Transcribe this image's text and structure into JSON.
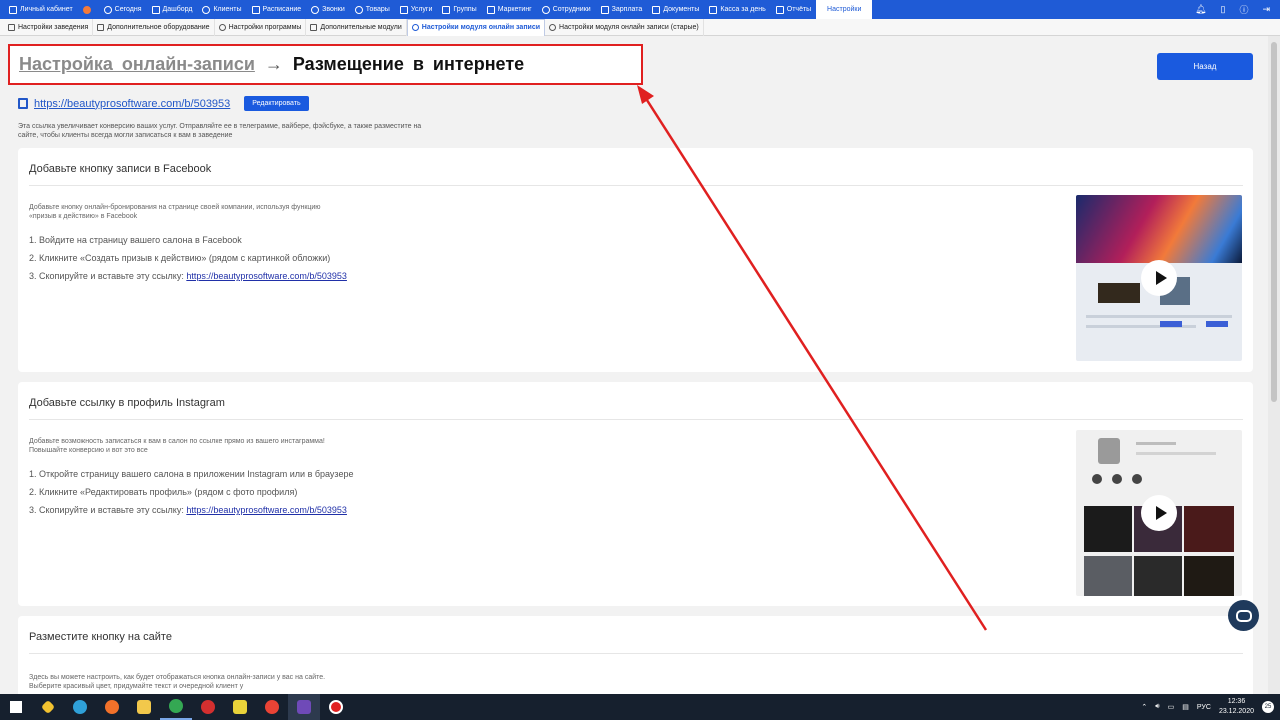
{
  "topnav": {
    "items": [
      {
        "label": "Личный кабинет",
        "icon": "user-card-icon"
      },
      {
        "label": "",
        "icon": "round-badge-icon"
      },
      {
        "label": "Сегодня",
        "icon": "calendar-today-icon"
      },
      {
        "label": "Дашборд",
        "icon": "chart-icon"
      },
      {
        "label": "Клиенты",
        "icon": "client-icon"
      },
      {
        "label": "Расписание",
        "icon": "schedule-icon"
      },
      {
        "label": "Звонки",
        "icon": "phone-icon"
      },
      {
        "label": "Товары",
        "icon": "goods-icon"
      },
      {
        "label": "Услуги",
        "icon": "lightning-icon"
      },
      {
        "label": "Группы",
        "icon": "group-icon"
      },
      {
        "label": "Маркетинг",
        "icon": "megaphone-icon"
      },
      {
        "label": "Сотрудники",
        "icon": "staff-icon"
      },
      {
        "label": "Зарплата",
        "icon": "salary-icon"
      },
      {
        "label": "Документы",
        "icon": "document-icon"
      },
      {
        "label": "Касса за день",
        "icon": "cash-register-icon"
      },
      {
        "label": "Отчёты",
        "icon": "reports-icon"
      }
    ],
    "active_label": "Настройки"
  },
  "subtabs": [
    {
      "label": "Настройки заведения"
    },
    {
      "label": "Дополнительное оборудование"
    },
    {
      "label": "Настройки программы"
    },
    {
      "label": "Дополнительные модули"
    },
    {
      "label": "Настройки модуля онлайн записи",
      "active": true
    },
    {
      "label": "Настройки модуля онлайн записи (старые)"
    }
  ],
  "page": {
    "breadcrumb_parent": "Настройка онлайн-записи",
    "breadcrumb_arrow": "→",
    "breadcrumb_current": "Размещение в интернете",
    "back_label": "Назад",
    "link_url": "https://beautyprosoftware.com/b/503953",
    "edit_label": "Редактировать",
    "hint": "Эта ссылка увеличивает конверсию ваших услуг. Отправляйте ее в телеграмме, вайбере, фэйсбуке, а также разместите на сайте, чтобы клиенты всегда могли записаться к вам в заведение"
  },
  "facebook": {
    "title": "Добавьте кнопку записи в Facebook",
    "desc": "Добавьте кнопку онлайн-бронирования на странице своей компании, используя функцию «призыв к действию» в Facebook",
    "step1": "1. Войдите на страницу вашего салона в Facebook",
    "step2": "2. Кликните «Создать призыв к действию» (рядом с картинкой обложки)",
    "step3_text": "3. Скопируйте и вставьте эту ссылку: ",
    "step3_link": "https://beautyprosoftware.com/b/503953"
  },
  "instagram": {
    "title": "Добавьте ссылку в профиль Instagram",
    "desc": "Добавьте возможность записаться к вам в салон по ссылке прямо из вашего инстаграмма! Повышайте конверсию и вот это все",
    "step1": "1. Откройте страницу вашего салона в приложении Instagram или в браузере",
    "step2": "2. Кликните «Редактировать профиль» (рядом с фото профиля)",
    "step3_text": "3. Скопируйте и вставьте эту ссылку: ",
    "step3_link": "https://beautyprosoftware.com/b/503953"
  },
  "site": {
    "title": "Разместите кнопку на сайте",
    "desc": "Здесь вы можете настроить, как будет отображаться кнопка онлайн-записи у вас на сайте. Выберите красивый цвет, придумайте текст и очередной клиент у"
  },
  "taskbar": {
    "lang": "РУС",
    "time": "12:36",
    "date": "23.12.2020",
    "badge": "25"
  },
  "colors": {
    "nav": "#1f5bd6",
    "button": "#1a5adf",
    "annotation": "#e02020"
  }
}
